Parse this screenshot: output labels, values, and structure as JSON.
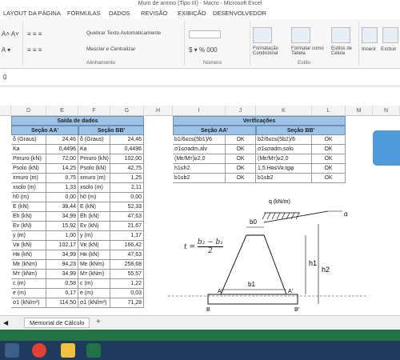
{
  "window": {
    "title": "Muro de arrimo (Tipo III) - Macro - Microsoft Excel"
  },
  "menu": [
    "LAYOUT DA PÁGINA",
    "FÓRMULAS",
    "DADOS",
    "REVISÃO",
    "EXIBIÇÃO",
    "DESENVOLVEDOR"
  ],
  "ribbon": {
    "wrap": "Quebrar Texto Automaticamente",
    "merge": "Mesclar e Centralizar",
    "align_group": "Alinhamento",
    "number_group": "Número",
    "cond_format": "Formatação Condicional",
    "format_table": "Formatar como Tabela",
    "cell_styles": "Estilos de Célula",
    "styles_group": "Estilo",
    "insert": "Inserir",
    "delete": "Excluir"
  },
  "formula": {
    "value": "0"
  },
  "columns": [
    "D",
    "E",
    "F",
    "G",
    "H",
    "I",
    "J",
    "K",
    "L",
    "M",
    "N"
  ],
  "output": {
    "title": "Saída de dados",
    "secA": "Seção AA'",
    "secB": "Seção BB'",
    "rows": [
      [
        "δ (Graus)",
        "24,46",
        "δ (Graus)",
        "24,46"
      ],
      [
        "Ka",
        "0,4496",
        "Ka",
        "0,4496"
      ],
      [
        "Pmuro (kN)",
        "72,00",
        "Pmuro (kN)",
        "102,00"
      ],
      [
        "Psolo (kN)",
        "14,25",
        "Psolo (kN)",
        "42,75"
      ],
      [
        "xmuro (m)",
        "0,75",
        "xmuro (m)",
        "1,25"
      ],
      [
        "xsolo (m)",
        "1,33",
        "xsolo (m)",
        "2,11"
      ],
      [
        "h0 (m)",
        "0,00",
        "h0 (m)",
        "0,00"
      ],
      [
        "E (kN)",
        "38,44",
        "E (kN)",
        "52,33"
      ],
      [
        "Eh (kN)",
        "34,99",
        "Eh (kN)",
        "47,63"
      ],
      [
        "Ev (kN)",
        "15,92",
        "Ev (kN)",
        "21,67"
      ],
      [
        "y (m)",
        "1,00",
        "y (m)",
        "1,17"
      ],
      [
        "Vʀ (kN)",
        "102,17",
        "Vʀ (kN)",
        "166,42"
      ],
      [
        "Hʀ (kN)",
        "34,99",
        "Hʀ (kN)",
        "47,63"
      ],
      [
        "Mᴇ (kNm)",
        "94,23",
        "Mᴇ (kNm)",
        "258,68"
      ],
      [
        "Mᴛ (kNm)",
        "34,99",
        "Mᴛ (kNm)",
        "55,57"
      ],
      [
        "c (m)",
        "0,58",
        "c (m)",
        "1,22"
      ],
      [
        "e (m)",
        "0,17",
        "e (m)",
        "0,03"
      ],
      [
        "σ1 (kN/m²)",
        "114,50",
        "σ1 (kN/m²)",
        "71,28"
      ]
    ]
  },
  "checks": {
    "title": "Verificações",
    "secA": "Seção AA'",
    "secB": "Seção BB'",
    "rows": [
      [
        "b1/6≤c≤(5b1)/6",
        "OK",
        "b2/6≤c≤(5b2)/6",
        "OK"
      ],
      [
        "σ1≤σadm,alv",
        "OK",
        "σ1≤σadm,solo",
        "OK"
      ],
      [
        "(Mᴇ/Mᴛ)≥2,0",
        "OK",
        "(Mᴇ/Mᴛ)≥2,0",
        "OK"
      ],
      [
        "h1≤h2",
        "OK",
        "1,5.Hʀ≤Vʀ.tgφ",
        "OK"
      ],
      [
        "b1≤b2",
        "OK",
        "b1≤b2",
        "OK"
      ]
    ]
  },
  "diagram": {
    "q": "q (kN/m)",
    "b0": "b0",
    "b1": "b1",
    "h1": "h1",
    "h2": "h2",
    "A": "A",
    "A2": "A'",
    "B": "B",
    "B2": "B'",
    "alpha": "α",
    "formula_t": "t =",
    "formula_num": "b₂ − b₁",
    "formula_den": "2"
  },
  "sheet": {
    "tab": "Memorial de Cálculo",
    "add": "+"
  },
  "colors": {
    "accent": "#217346",
    "header": "#9dc3e6",
    "macro": "#4f9ad8"
  }
}
